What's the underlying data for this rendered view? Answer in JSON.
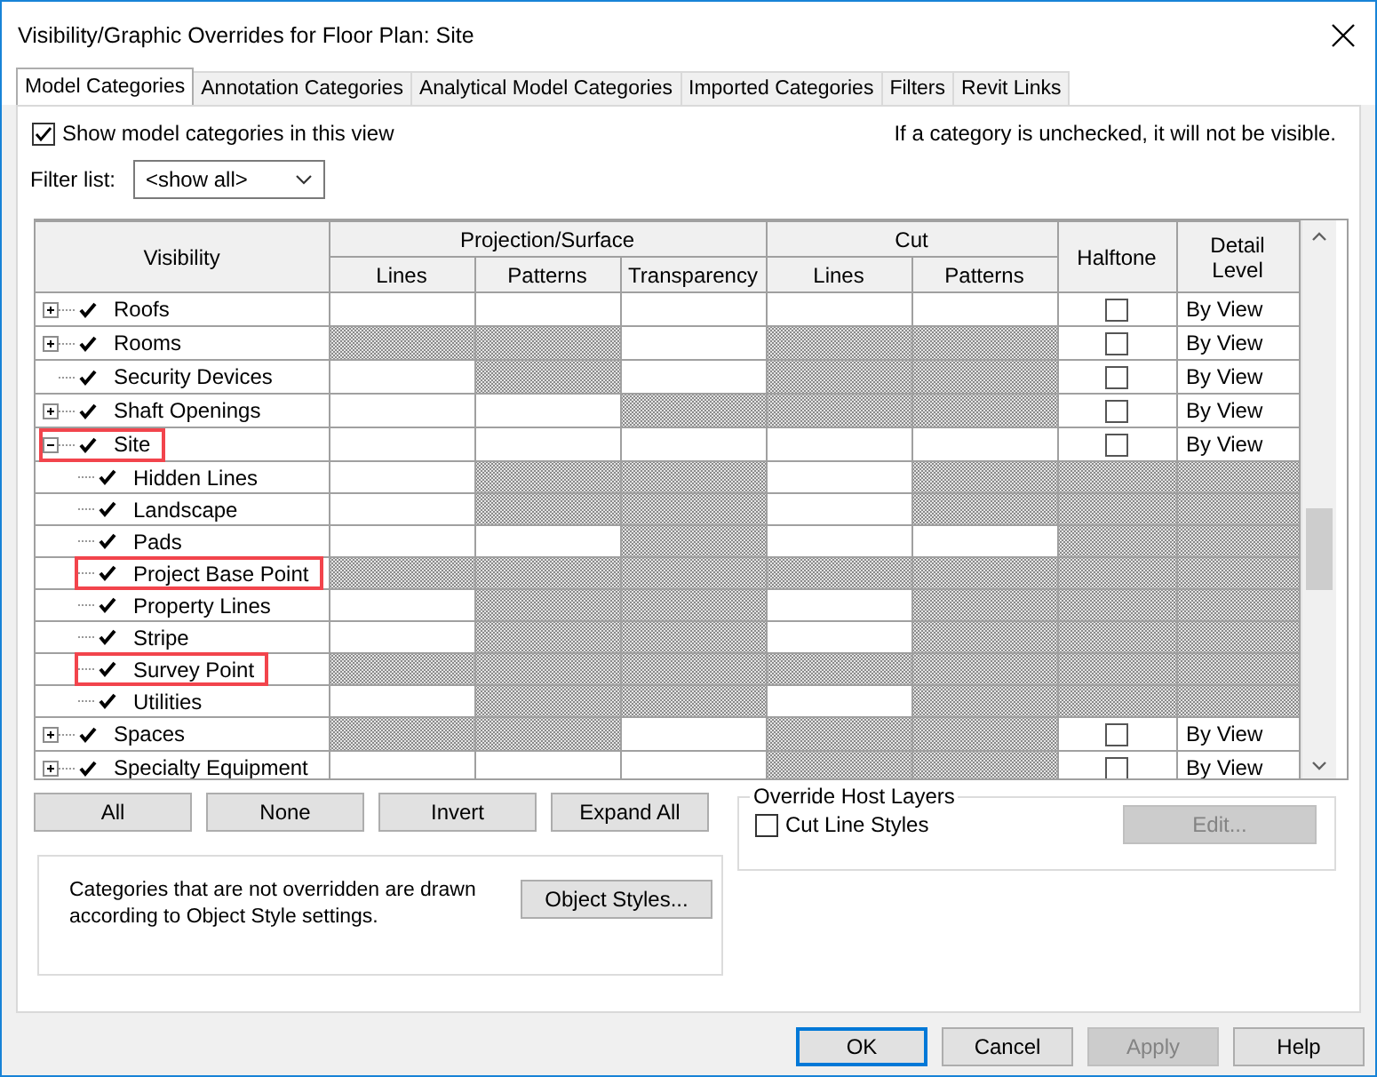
{
  "window": {
    "title": "Visibility/Graphic Overrides for Floor Plan: Site"
  },
  "tabs": [
    {
      "label": "Model Categories",
      "selected": true
    },
    {
      "label": "Annotation Categories",
      "selected": false
    },
    {
      "label": "Analytical Model Categories",
      "selected": false
    },
    {
      "label": "Imported Categories",
      "selected": false
    },
    {
      "label": "Filters",
      "selected": false
    },
    {
      "label": "Revit Links",
      "selected": false
    }
  ],
  "show_categories": {
    "label": "Show model categories in this view",
    "checked": true
  },
  "hint": "If a category is unchecked, it will not be visible.",
  "filter": {
    "label": "Filter list:",
    "value": "<show all>"
  },
  "table": {
    "columns": {
      "visibility": "Visibility",
      "projection": "Projection/Surface",
      "cut": "Cut",
      "halftone": "Halftone",
      "detail_level": "Detail Level",
      "lines": "Lines",
      "patterns": "Patterns",
      "transparency": "Transparency",
      "cut_lines": "Lines",
      "cut_patterns": "Patterns"
    },
    "rows": [
      {
        "name": "Roofs",
        "checked": true,
        "expandable": true,
        "expanded": false,
        "highlighted": false,
        "cells": [
          {
            "hatched": false
          },
          {
            "hatched": false
          },
          {
            "hatched": false
          },
          {
            "hatched": false
          },
          {
            "hatched": false
          }
        ],
        "halftone": {
          "hatched": false,
          "checked": false
        },
        "detail": {
          "hatched": false,
          "text": "By View"
        }
      },
      {
        "name": "Rooms",
        "checked": true,
        "expandable": true,
        "expanded": false,
        "highlighted": false,
        "cells": [
          {
            "hatched": true
          },
          {
            "hatched": true
          },
          {
            "hatched": false
          },
          {
            "hatched": true
          },
          {
            "hatched": true
          }
        ],
        "halftone": {
          "hatched": false,
          "checked": false
        },
        "detail": {
          "hatched": false,
          "text": "By View"
        }
      },
      {
        "name": "Security Devices",
        "checked": true,
        "expandable": false,
        "highlighted": false,
        "cells": [
          {
            "hatched": false
          },
          {
            "hatched": true
          },
          {
            "hatched": false
          },
          {
            "hatched": true
          },
          {
            "hatched": true
          }
        ],
        "halftone": {
          "hatched": false,
          "checked": false
        },
        "detail": {
          "hatched": false,
          "text": "By View"
        }
      },
      {
        "name": "Shaft Openings",
        "checked": true,
        "expandable": true,
        "expanded": false,
        "highlighted": false,
        "cells": [
          {
            "hatched": false
          },
          {
            "hatched": false
          },
          {
            "hatched": true
          },
          {
            "hatched": true
          },
          {
            "hatched": true
          }
        ],
        "halftone": {
          "hatched": false,
          "checked": false
        },
        "detail": {
          "hatched": false,
          "text": "By View"
        }
      },
      {
        "name": "Site",
        "checked": true,
        "expandable": true,
        "expanded": true,
        "highlighted": true,
        "cells": [
          {
            "hatched": false
          },
          {
            "hatched": false
          },
          {
            "hatched": false
          },
          {
            "hatched": false
          },
          {
            "hatched": false
          }
        ],
        "halftone": {
          "hatched": false,
          "checked": false
        },
        "detail": {
          "hatched": false,
          "text": "By View"
        },
        "children": [
          {
            "name": "Hidden Lines",
            "checked": true,
            "highlighted": false,
            "cells": [
              {
                "hatched": false
              },
              {
                "hatched": true
              },
              {
                "hatched": true
              },
              {
                "hatched": false
              },
              {
                "hatched": true
              }
            ],
            "halftone": {
              "hatched": true
            },
            "detail": {
              "hatched": true
            }
          },
          {
            "name": "Landscape",
            "checked": true,
            "highlighted": false,
            "cells": [
              {
                "hatched": false
              },
              {
                "hatched": true
              },
              {
                "hatched": true
              },
              {
                "hatched": false
              },
              {
                "hatched": true
              }
            ],
            "halftone": {
              "hatched": true
            },
            "detail": {
              "hatched": true
            }
          },
          {
            "name": "Pads",
            "checked": true,
            "highlighted": false,
            "cells": [
              {
                "hatched": false
              },
              {
                "hatched": false
              },
              {
                "hatched": true
              },
              {
                "hatched": false
              },
              {
                "hatched": false
              }
            ],
            "halftone": {
              "hatched": true
            },
            "detail": {
              "hatched": true
            }
          },
          {
            "name": "Project Base Point",
            "checked": true,
            "highlighted": true,
            "cells": [
              {
                "hatched": true
              },
              {
                "hatched": true
              },
              {
                "hatched": true
              },
              {
                "hatched": true
              },
              {
                "hatched": true
              }
            ],
            "halftone": {
              "hatched": true
            },
            "detail": {
              "hatched": true
            }
          },
          {
            "name": "Property Lines",
            "checked": true,
            "highlighted": false,
            "cells": [
              {
                "hatched": false
              },
              {
                "hatched": true
              },
              {
                "hatched": true
              },
              {
                "hatched": false
              },
              {
                "hatched": true
              }
            ],
            "halftone": {
              "hatched": true
            },
            "detail": {
              "hatched": true
            }
          },
          {
            "name": "Stripe",
            "checked": true,
            "highlighted": false,
            "cells": [
              {
                "hatched": false
              },
              {
                "hatched": true
              },
              {
                "hatched": true
              },
              {
                "hatched": false
              },
              {
                "hatched": true
              }
            ],
            "halftone": {
              "hatched": true
            },
            "detail": {
              "hatched": true
            }
          },
          {
            "name": "Survey Point",
            "checked": true,
            "highlighted": true,
            "cells": [
              {
                "hatched": true
              },
              {
                "hatched": true
              },
              {
                "hatched": true
              },
              {
                "hatched": true
              },
              {
                "hatched": true
              }
            ],
            "halftone": {
              "hatched": true
            },
            "detail": {
              "hatched": true
            }
          },
          {
            "name": "Utilities",
            "checked": true,
            "highlighted": false,
            "cells": [
              {
                "hatched": false
              },
              {
                "hatched": true
              },
              {
                "hatched": true
              },
              {
                "hatched": false
              },
              {
                "hatched": true
              }
            ],
            "halftone": {
              "hatched": true
            },
            "detail": {
              "hatched": true
            }
          }
        ]
      },
      {
        "name": "Spaces",
        "checked": true,
        "expandable": true,
        "expanded": false,
        "highlighted": false,
        "cells": [
          {
            "hatched": true
          },
          {
            "hatched": true
          },
          {
            "hatched": false
          },
          {
            "hatched": true
          },
          {
            "hatched": true
          }
        ],
        "halftone": {
          "hatched": false,
          "checked": false
        },
        "detail": {
          "hatched": false,
          "text": "By View"
        }
      },
      {
        "name": "Specialty Equipment",
        "checked": true,
        "expandable": true,
        "expanded": false,
        "highlighted": false,
        "cells": [
          {
            "hatched": false
          },
          {
            "hatched": false
          },
          {
            "hatched": false
          },
          {
            "hatched": true
          },
          {
            "hatched": true
          }
        ],
        "halftone": {
          "hatched": false,
          "checked": false
        },
        "detail": {
          "hatched": false,
          "text": "By View"
        }
      }
    ]
  },
  "selection_buttons": [
    "All",
    "None",
    "Invert",
    "Expand All"
  ],
  "object_styles": {
    "note": "Categories that are not overridden are drawn according to Object Style settings.",
    "button": "Object Styles..."
  },
  "override_host_layers": {
    "title": "Override Host Layers",
    "option": {
      "label": "Cut Line Styles",
      "checked": false
    },
    "edit": {
      "label": "Edit...",
      "disabled": true
    }
  },
  "footer_buttons": [
    {
      "label": "OK",
      "default": true,
      "disabled": false
    },
    {
      "label": "Cancel",
      "default": false,
      "disabled": false
    },
    {
      "label": "Apply",
      "default": false,
      "disabled": true
    },
    {
      "label": "Help",
      "default": false,
      "disabled": false
    }
  ]
}
